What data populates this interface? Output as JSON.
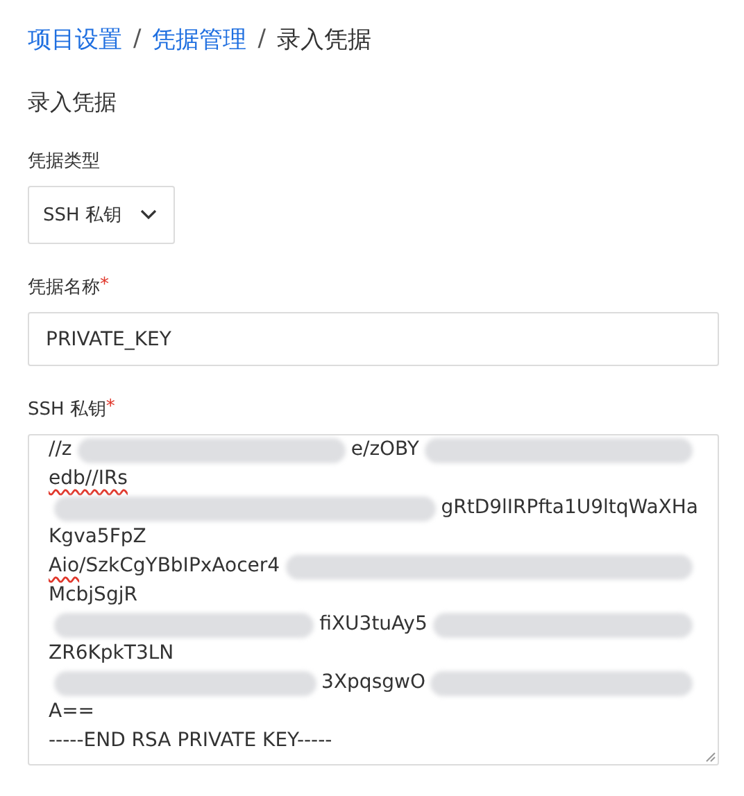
{
  "breadcrumb": [
    {
      "label": "项目设置",
      "link": true
    },
    {
      "label": "凭据管理",
      "link": true
    },
    {
      "label": "录入凭据",
      "link": false
    }
  ],
  "breadcrumb_separator": "/",
  "heading": "录入凭据",
  "type_field": {
    "label": "凭据类型",
    "value": "SSH 私钥"
  },
  "name_field": {
    "label": "凭据名称",
    "required_mark": "*",
    "value": "PRIVATE_KEY"
  },
  "key_field": {
    "label": "SSH 私钥",
    "required_mark": "*",
    "lines": [
      [
        {
          "kind": "text",
          "text": "//z"
        },
        {
          "kind": "redacted"
        },
        {
          "kind": "text",
          "text": "e/zOBY"
        },
        {
          "kind": "redacted"
        }
      ],
      [
        {
          "kind": "spell",
          "text": "edb//IRs"
        }
      ],
      [
        {
          "kind": "redacted"
        },
        {
          "kind": "text",
          "text": "gRtD9lIRPfta1U9ltqWaXHa"
        }
      ],
      [
        {
          "kind": "text",
          "text": "Kgva5FpZ"
        }
      ],
      [
        {
          "kind": "spell",
          "text": "Aio"
        },
        {
          "kind": "text",
          "text": "/SzkCgYBbIPxAocer4"
        },
        {
          "kind": "redacted"
        }
      ],
      [
        {
          "kind": "text",
          "text": "McbjSgjR"
        }
      ],
      [
        {
          "kind": "redacted"
        },
        {
          "kind": "text",
          "text": "fiXU3tuAy5"
        },
        {
          "kind": "redacted"
        }
      ],
      [
        {
          "kind": "text",
          "text": "ZR6KpkT3LN"
        }
      ],
      [
        {
          "kind": "redacted"
        },
        {
          "kind": "text",
          "text": "3XpqsgwO"
        },
        {
          "kind": "redacted"
        }
      ],
      [
        {
          "kind": "text",
          "text": "A=="
        }
      ],
      [
        {
          "kind": "text",
          "text": "-----END RSA PRIVATE KEY-----"
        }
      ]
    ]
  }
}
